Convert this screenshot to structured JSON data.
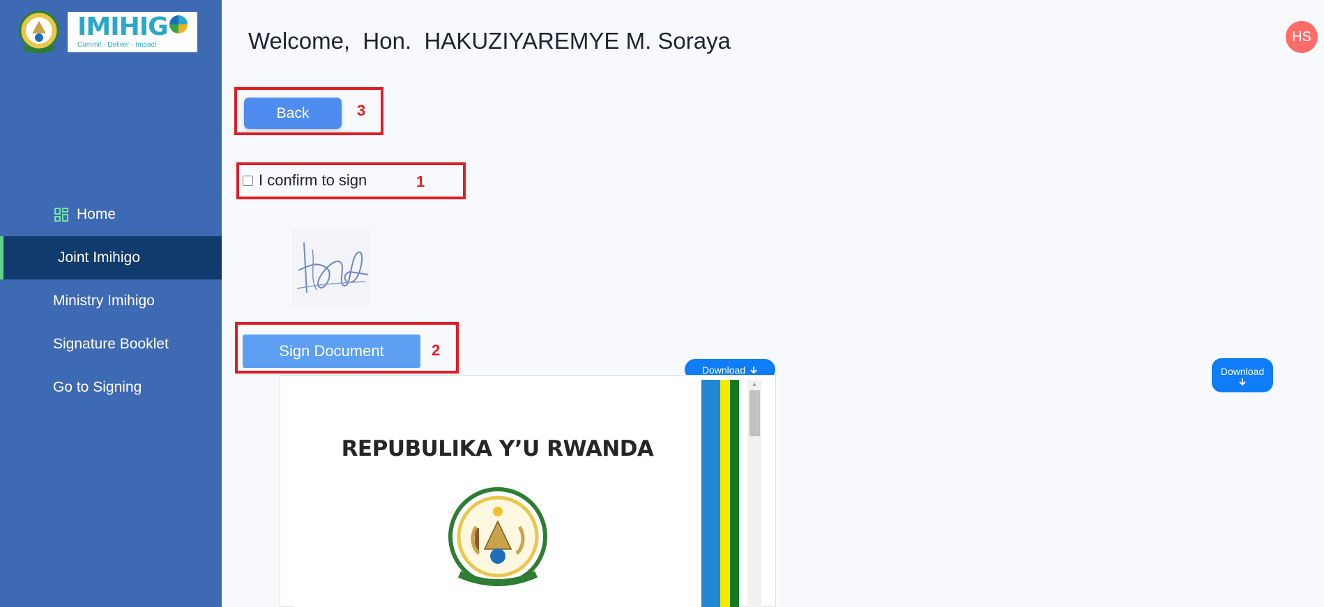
{
  "brand": {
    "name": "IMIHIG",
    "tagline": "Commit - Deliver - Impact"
  },
  "sidebar": {
    "items": [
      {
        "label": "Home",
        "icon": "dashboard-grid-icon",
        "active": false
      },
      {
        "label": "Joint Imihigo",
        "active": true
      },
      {
        "label": "Ministry Imihigo",
        "active": false
      },
      {
        "label": "Signature Booklet",
        "active": false
      },
      {
        "label": "Go to Signing",
        "active": false
      }
    ]
  },
  "header": {
    "welcome": "Welcome,  Hon.  HAKUZIYAREMYE M. Soraya",
    "avatar_initials": "HS"
  },
  "actions": {
    "back_label": "Back",
    "confirm_label": "I confirm to sign",
    "confirm_checked": false,
    "sign_label": "Sign Document",
    "download_label": "Download"
  },
  "annotations": {
    "back": "3",
    "confirm": "1",
    "sign": "2"
  },
  "document": {
    "title": "REPUBULIKA Y’U RWANDA"
  },
  "colors": {
    "sidebar": "#3e69b3",
    "sidebar_active": "#123b6d",
    "accent_bar": "#5fd38a",
    "primary_button": "#4f8cef",
    "download_button": "#0f7df7",
    "avatar": "#fc6d6a",
    "annotation": "#e11d24",
    "flag_blue": "#2087d5",
    "flag_yellow": "#f4ea00",
    "flag_green": "#157a1f"
  }
}
